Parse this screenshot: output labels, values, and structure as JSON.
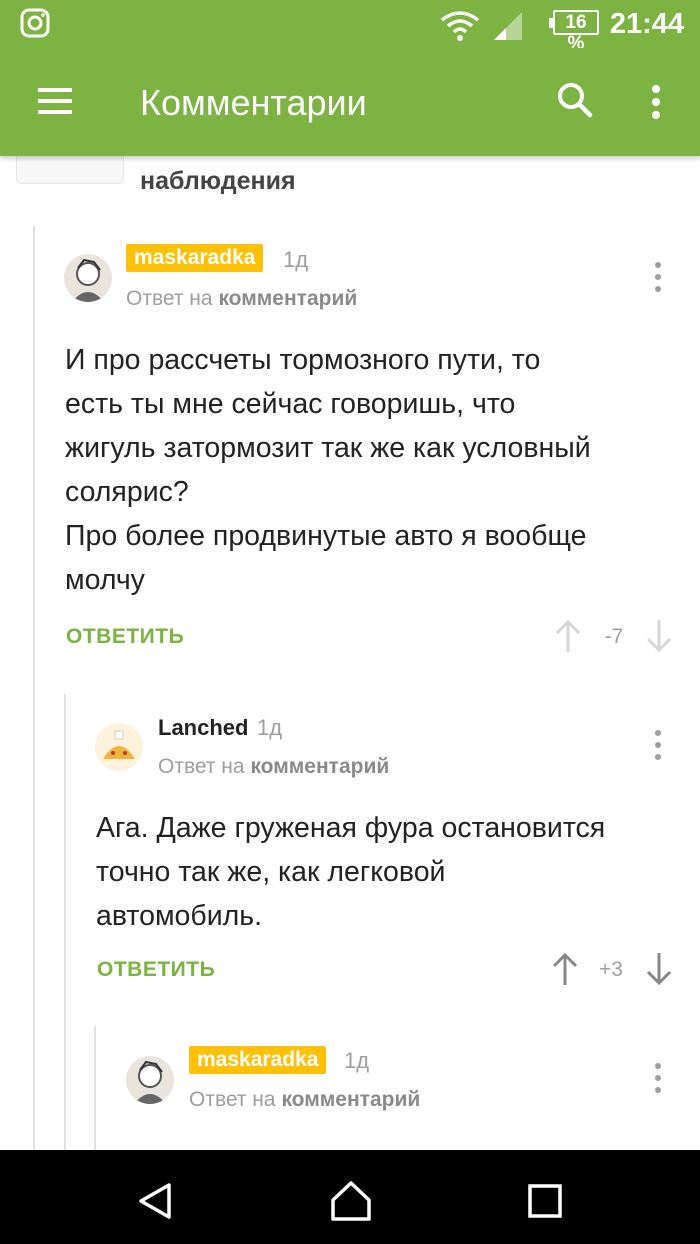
{
  "status": {
    "battery": "16 %",
    "time": "21:44"
  },
  "appbar": {
    "title": "Комментарии"
  },
  "prev": {
    "text": "наблюдения"
  },
  "comments": [
    {
      "nick": "maskaradka",
      "ago": "1д",
      "reply_prefix": "Ответ на",
      "reply_link": "комментарий",
      "body": "И про рассчеты тормозного пути, то\nесть ты мне сейчас говоришь, что\nжигуль затормозит так же как условный\nсолярис?\nПро более продвинутые авто я вообще\nмолчу",
      "reply_label": "ОТВЕТИТЬ",
      "score": "-7"
    },
    {
      "nick": "Lanched",
      "ago": "1д",
      "reply_prefix": "Ответ на",
      "reply_link": "комментарий",
      "body": "Ага. Даже груженая фура остановится\nточно так же, как легковой\nавтомобиль.",
      "reply_label": "ОТВЕТИТЬ",
      "score": "+3"
    },
    {
      "nick": "maskaradka",
      "ago": "1д",
      "reply_prefix": "Ответ на",
      "reply_link": "комментарий"
    }
  ],
  "colors": {
    "accent": "#7cb342",
    "badge": "#ffc107",
    "muted": "#9e9e9e"
  },
  "icons": [
    "instagram-icon",
    "wifi-icon",
    "signal-icon",
    "battery-icon",
    "menu-icon",
    "search-icon",
    "more-vert-icon",
    "arrow-up-icon",
    "arrow-down-icon",
    "back-icon",
    "home-icon",
    "recents-icon"
  ]
}
